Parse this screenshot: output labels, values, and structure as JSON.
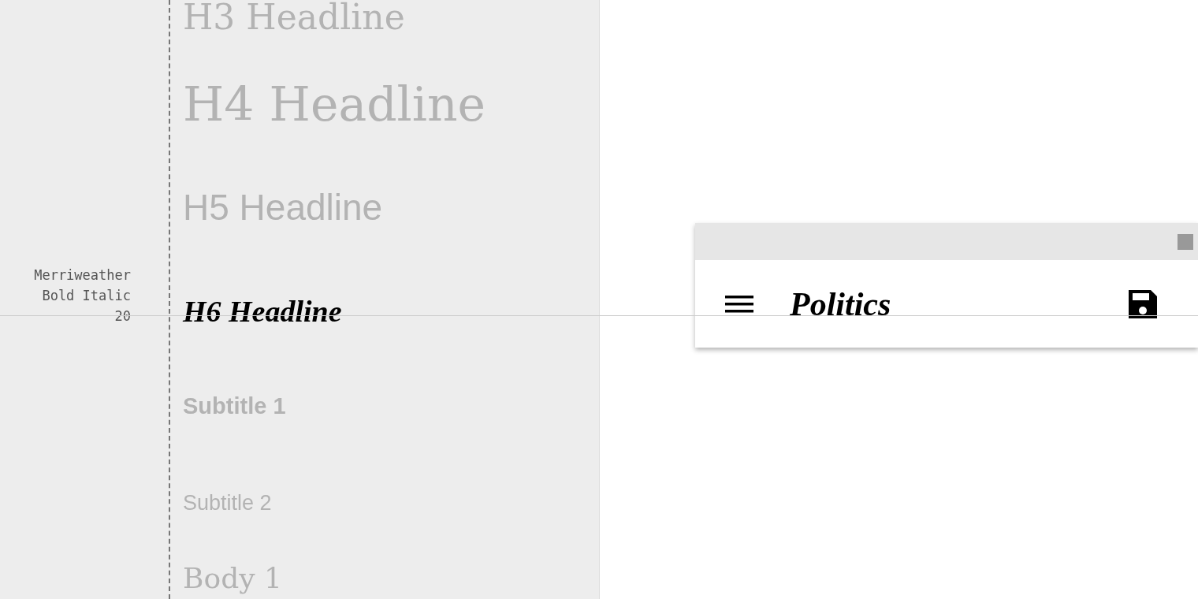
{
  "type_scale": {
    "specimens": [
      {
        "text": "H3 Headline",
        "kind": "h3",
        "highlighted": false
      },
      {
        "text": "H4 Headline",
        "kind": "h4",
        "highlighted": false
      },
      {
        "text": "H5 Headline",
        "kind": "h5",
        "highlighted": false
      },
      {
        "text": "H6 Headline",
        "kind": "h6",
        "highlighted": true,
        "spec": "Merriweather\nBold Italic\n20"
      },
      {
        "text": "Subtitle 1",
        "kind": "subtitle1",
        "highlighted": false
      },
      {
        "text": "Subtitle 2",
        "kind": "subtitle2",
        "highlighted": false
      },
      {
        "text": "Body 1",
        "kind": "body1",
        "highlighted": false
      }
    ]
  },
  "preview": {
    "app_bar": {
      "title": "Politics"
    }
  }
}
